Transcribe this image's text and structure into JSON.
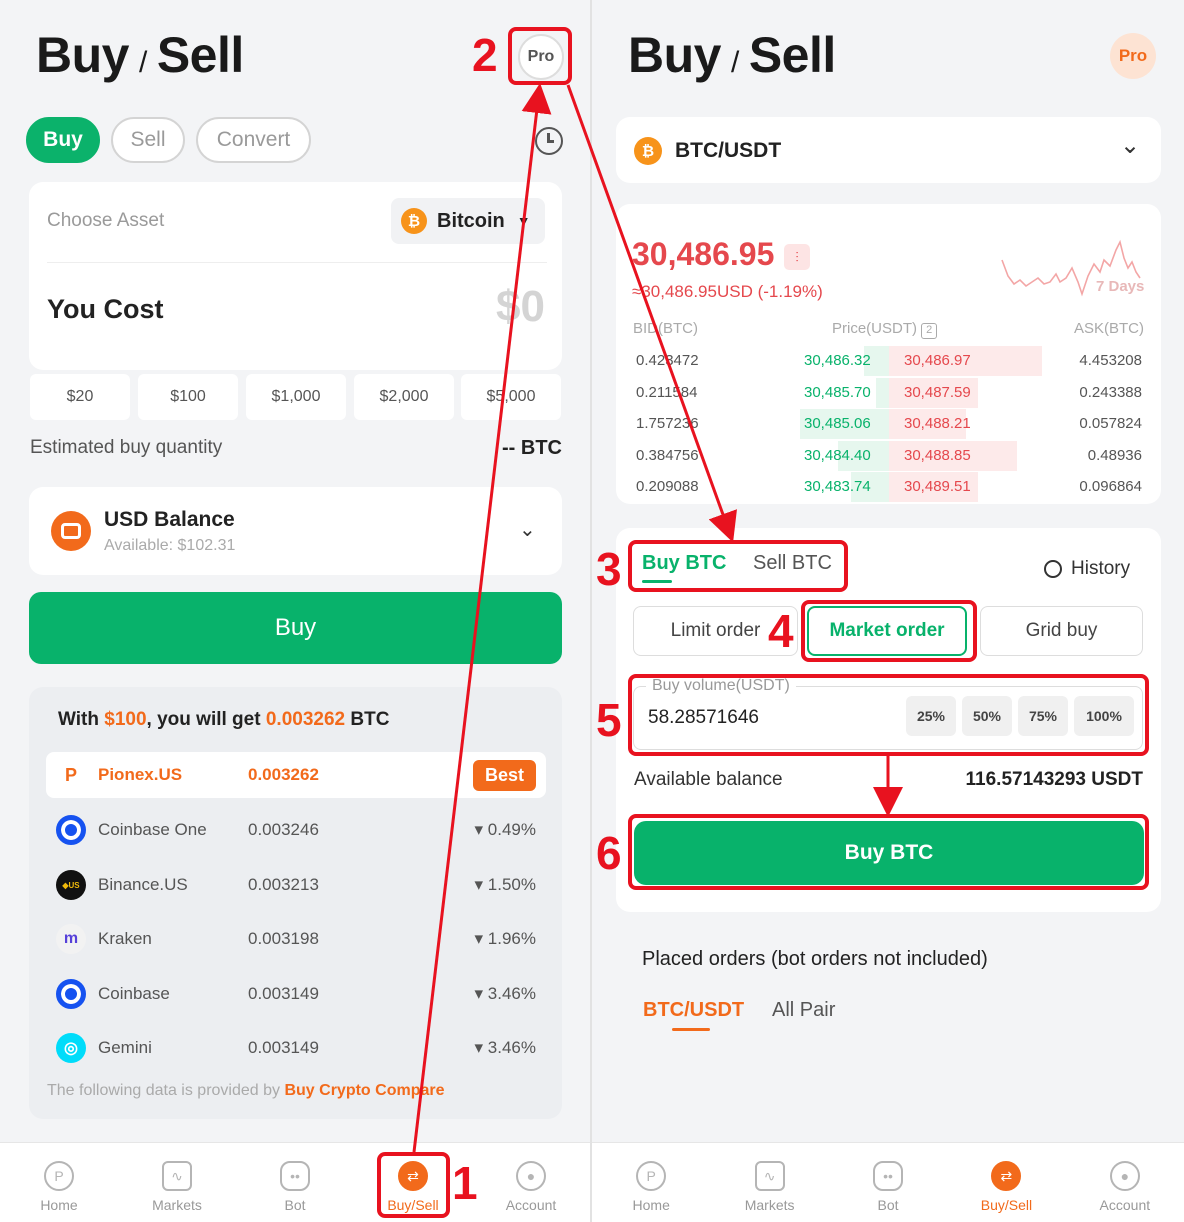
{
  "left": {
    "title_buy": "Buy",
    "title_sep": "/",
    "title_sell": "Sell",
    "pro_label": "Pro",
    "tabs": [
      "Buy",
      "Sell",
      "Convert"
    ],
    "choose_asset_label": "Choose Asset",
    "asset": "Bitcoin",
    "you_cost_label": "You Cost",
    "cost_value": "$0",
    "quick_amounts": [
      "$20",
      "$100",
      "$1,000",
      "$2,000",
      "$5,000"
    ],
    "est_label": "Estimated buy quantity",
    "est_value": "-- BTC",
    "balance_title": "USD Balance",
    "balance_available": "Available: $102.31",
    "buy_button": "Buy",
    "compare_prefix": "With ",
    "compare_amount": "$100",
    "compare_mid": ", you will get ",
    "compare_qty": "0.003262",
    "compare_suffix": " BTC",
    "exchanges": [
      {
        "name": "Pionex.US",
        "qty": "0.003262",
        "diff": "Best"
      },
      {
        "name": "Coinbase One",
        "qty": "0.003246",
        "diff": "▾ 0.49%"
      },
      {
        "name": "Binance.US",
        "qty": "0.003213",
        "diff": "▾ 1.50%"
      },
      {
        "name": "Kraken",
        "qty": "0.003198",
        "diff": "▾ 1.96%"
      },
      {
        "name": "Coinbase",
        "qty": "0.003149",
        "diff": "▾ 3.46%"
      },
      {
        "name": "Gemini",
        "qty": "0.003149",
        "diff": "▾ 3.46%"
      }
    ],
    "provider_prefix": "The following data is provided by ",
    "provider_link": "Buy Crypto Compare"
  },
  "right": {
    "title_buy": "Buy",
    "title_sep": "/",
    "title_sell": "Sell",
    "pro_label": "Pro",
    "pair": "BTC/USDT",
    "price": "30,486.95",
    "price_usd": "≈30,486.95USD (-1.19%)",
    "range_label": "7 Days",
    "ob_headers": [
      "BID(BTC)",
      "Price(USDT)",
      "ASK(BTC)"
    ],
    "ob_rows": [
      {
        "bid": "0.423472",
        "bid_price": "30,486.32",
        "ask_price": "30,486.97",
        "ask": "4.453208",
        "bid_depth": 0.1,
        "ask_depth": 0.6
      },
      {
        "bid": "0.211584",
        "bid_price": "30,485.70",
        "ask_price": "30,487.59",
        "ask": "0.243388",
        "bid_depth": 0.05,
        "ask_depth": 0.35
      },
      {
        "bid": "1.757236",
        "bid_price": "30,485.06",
        "ask_price": "30,488.21",
        "ask": "0.057824",
        "bid_depth": 0.35,
        "ask_depth": 0.3
      },
      {
        "bid": "0.384756",
        "bid_price": "30,484.40",
        "ask_price": "30,488.85",
        "ask": "0.48936",
        "bid_depth": 0.2,
        "ask_depth": 0.5
      },
      {
        "bid": "0.209088",
        "bid_price": "30,483.74",
        "ask_price": "30,489.51",
        "ask": "0.096864",
        "bid_depth": 0.15,
        "ask_depth": 0.35
      }
    ],
    "side_tabs": [
      "Buy BTC",
      "Sell BTC"
    ],
    "history_label": "History",
    "order_types": [
      "Limit order",
      "Market order",
      "Grid buy"
    ],
    "volume_label": "Buy volume(USDT)",
    "volume_value": "58.28571646",
    "percents": [
      "25%",
      "50%",
      "75%",
      "100%"
    ],
    "avail_label": "Available balance",
    "avail_value": "116.57143293 USDT",
    "buy_button": "Buy BTC",
    "placed_title": "Placed orders (bot orders not included)",
    "placed_tabs": [
      "BTC/USDT",
      "All Pair"
    ]
  },
  "nav": [
    "Home",
    "Markets",
    "Bot",
    "Buy/Sell",
    "Account"
  ],
  "steps": [
    "1",
    "2",
    "3",
    "4",
    "5",
    "6"
  ],
  "colors": {
    "green": "#08b26b",
    "orange": "#f26a1b",
    "red_annotation": "#e8121f",
    "price_red": "#e5484d"
  }
}
